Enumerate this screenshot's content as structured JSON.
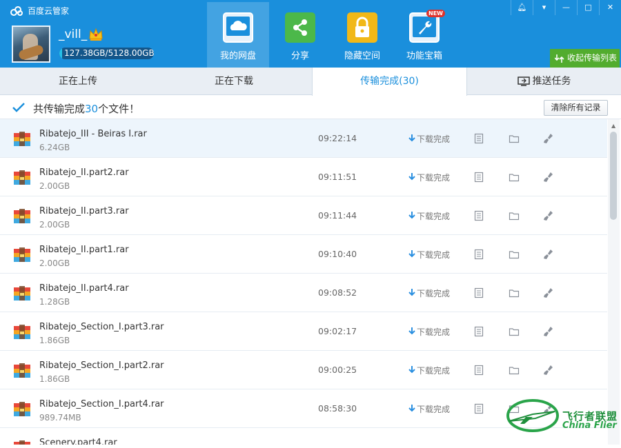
{
  "app": {
    "title": "百度云管家"
  },
  "user": {
    "name": "_vill_",
    "quota_text": "127.38GB/5128.00GB",
    "quota_fraction": 0.0248
  },
  "nav": [
    {
      "label": "我的网盘",
      "icon": "cloud-drive-icon",
      "active": true
    },
    {
      "label": "分享",
      "icon": "share-icon"
    },
    {
      "label": "隐藏空间",
      "icon": "lock-icon"
    },
    {
      "label": "功能宝箱",
      "icon": "toolbox-icon",
      "badge": "NEW"
    }
  ],
  "window_controls": [
    "notification",
    "menu",
    "minimize",
    "maximize",
    "close"
  ],
  "collapse_button": "收起传输列表",
  "tabs": [
    {
      "label": "正在上传"
    },
    {
      "label": "正在下载"
    },
    {
      "label": "传输完成(30)",
      "active": true
    },
    {
      "label": "推送任务"
    }
  ],
  "summary": {
    "prefix": "共传输完成",
    "count": "30",
    "suffix": "个文件！",
    "clear_label": "清除所有记录"
  },
  "files": [
    {
      "name": "Ribatejo_III - Beiras I.rar",
      "size": "6.24GB",
      "time": "09:22:14",
      "status": "下载完成"
    },
    {
      "name": "Ribatejo_II.part2.rar",
      "size": "2.00GB",
      "time": "09:11:51",
      "status": "下载完成"
    },
    {
      "name": "Ribatejo_II.part3.rar",
      "size": "2.00GB",
      "time": "09:11:44",
      "status": "下载完成"
    },
    {
      "name": "Ribatejo_II.part1.rar",
      "size": "2.00GB",
      "time": "09:10:40",
      "status": "下载完成"
    },
    {
      "name": "Ribatejo_II.part4.rar",
      "size": "1.28GB",
      "time": "09:08:52",
      "status": "下载完成"
    },
    {
      "name": "Ribatejo_Section_I.part3.rar",
      "size": "1.86GB",
      "time": "09:02:17",
      "status": "下载完成"
    },
    {
      "name": "Ribatejo_Section_I.part2.rar",
      "size": "1.86GB",
      "time": "09:00:25",
      "status": "下载完成"
    },
    {
      "name": "Ribatejo_Section_I.part4.rar",
      "size": "989.74MB",
      "time": "08:58:30",
      "status": "下载完成"
    },
    {
      "name": "Scenery.part4.rar",
      "size": "",
      "time": "",
      "status": ""
    }
  ],
  "watermark": {
    "cn": "飞行者联盟",
    "en": "China Flier"
  },
  "colors": {
    "header": "#1a8fdc",
    "accent": "#1a8fdc",
    "green": "#52ac2e"
  }
}
